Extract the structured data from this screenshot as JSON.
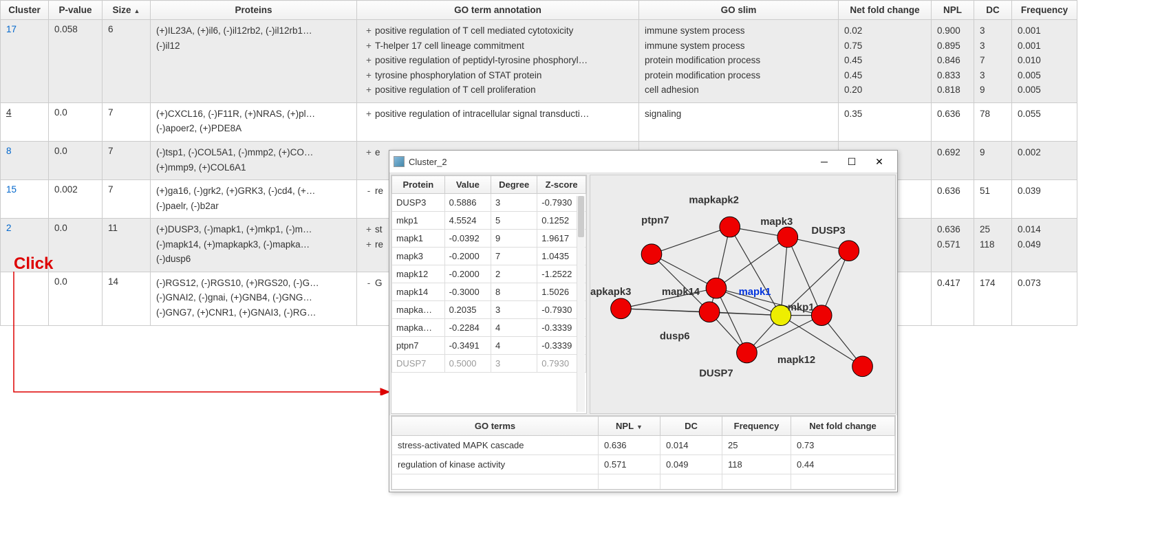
{
  "main_headers": {
    "cluster": "Cluster",
    "pvalue": "P-value",
    "size": "Size",
    "proteins": "Proteins",
    "go_term": "GO term annotation",
    "go_slim": "GO slim",
    "net_fold": "Net fold change",
    "npl": "NPL",
    "dc": "DC",
    "freq": "Frequency"
  },
  "rows": [
    {
      "cluster": "17",
      "pvalue": "0.058",
      "size": "6",
      "proteins": [
        "(+)IL23A, (+)il6, (-)il12rb2, (-)il12rb1…",
        "(-)il12"
      ],
      "go": [
        {
          "sign": "+",
          "term": "positive regulation of T cell mediated cytotoxicity",
          "slim": "immune system process",
          "nf": "0.02",
          "npl": "0.900",
          "dc": "3",
          "freq": "0.001"
        },
        {
          "sign": "+",
          "term": "T-helper 17 cell lineage commitment",
          "slim": "immune system process",
          "nf": "0.75",
          "npl": "0.895",
          "dc": "3",
          "freq": "0.001"
        },
        {
          "sign": "+",
          "term": "positive regulation of peptidyl-tyrosine phosphoryl…",
          "slim": "protein modification process",
          "nf": "0.45",
          "npl": "0.846",
          "dc": "7",
          "freq": "0.010"
        },
        {
          "sign": "+",
          "term": "tyrosine phosphorylation of STAT protein",
          "slim": "protein modification process",
          "nf": "0.45",
          "npl": "0.833",
          "dc": "3",
          "freq": "0.005"
        },
        {
          "sign": "+",
          "term": "positive regulation of T cell proliferation",
          "slim": "cell adhesion",
          "nf": "0.20",
          "npl": "0.818",
          "dc": "9",
          "freq": "0.005"
        }
      ]
    },
    {
      "cluster": "4",
      "underline": true,
      "pvalue": "0.0",
      "size": "7",
      "proteins": [
        "(+)CXCL16, (-)F11R, (+)NRAS, (+)pl…",
        "(-)apoer2, (+)PDE8A"
      ],
      "go": [
        {
          "sign": "+",
          "term": "positive regulation of intracellular signal transducti…",
          "slim": "signaling",
          "nf": "0.35",
          "npl": "0.636",
          "dc": "78",
          "freq": "0.055"
        }
      ]
    },
    {
      "cluster": "8",
      "pvalue": "0.0",
      "size": "7",
      "proteins": [
        "(-)tsp1, (-)COL5A1, (-)mmp2, (+)CO…",
        "(+)mmp9, (+)COL6A1"
      ],
      "go": [
        {
          "sign": "+",
          "term": "e",
          "slim": "",
          "nf": "",
          "npl": "0.692",
          "dc": "9",
          "freq": "0.002"
        }
      ]
    },
    {
      "cluster": "15",
      "pvalue": "0.002",
      "size": "7",
      "proteins": [
        "(+)ga16, (-)grk2, (+)GRK3, (-)cd4, (+…",
        "(-)paelr, (-)b2ar"
      ],
      "go": [
        {
          "sign": "-",
          "term": "re",
          "slim": "",
          "nf": "",
          "npl": "0.636",
          "dc": "51",
          "freq": "0.039"
        }
      ]
    },
    {
      "cluster": "2",
      "pvalue": "0.0",
      "size": "11",
      "proteins": [
        "(+)DUSP3, (-)mapk1, (+)mkp1, (-)m…",
        "(-)mapk14, (+)mapkapk3, (-)mapka…",
        "(-)dusp6"
      ],
      "go": [
        {
          "sign": "+",
          "term": "st",
          "slim": "",
          "nf": "",
          "npl": "0.636",
          "dc": "25",
          "freq": "0.014"
        },
        {
          "sign": "+",
          "term": "re",
          "slim": "",
          "nf": "",
          "npl": "0.571",
          "dc": "118",
          "freq": "0.049"
        }
      ]
    },
    {
      "cluster": "",
      "pvalue": "0.0",
      "size": "14",
      "proteins": [
        "(-)RGS12, (-)RGS10, (+)RGS20, (-)G…",
        "(-)GNAI2, (-)gnai, (+)GNB4, (-)GNG…",
        "(-)GNG7, (+)CNR1, (+)GNAI3, (-)RG…"
      ],
      "go": [
        {
          "sign": "-",
          "term": "G",
          "slim": "",
          "nf": "",
          "npl": "0.417",
          "dc": "174",
          "freq": "0.073"
        }
      ]
    }
  ],
  "click_label": "Click",
  "popup": {
    "title": "Cluster_2",
    "protein_headers": {
      "protein": "Protein",
      "value": "Value",
      "degree": "Degree",
      "zscore": "Z-score"
    },
    "proteins": [
      {
        "p": "DUSP3",
        "v": "0.5886",
        "d": "3",
        "z": "-0.7930"
      },
      {
        "p": "mkp1",
        "v": "4.5524",
        "d": "5",
        "z": "0.1252"
      },
      {
        "p": "mapk1",
        "v": "-0.0392",
        "d": "9",
        "z": "1.9617"
      },
      {
        "p": "mapk3",
        "v": "-0.2000",
        "d": "7",
        "z": "1.0435"
      },
      {
        "p": "mapk12",
        "v": "-0.2000",
        "d": "2",
        "z": "-1.2522"
      },
      {
        "p": "mapk14",
        "v": "-0.3000",
        "d": "8",
        "z": "1.5026"
      },
      {
        "p": "mapka…",
        "v": "0.2035",
        "d": "3",
        "z": "-0.7930"
      },
      {
        "p": "mapka…",
        "v": "-0.2284",
        "d": "4",
        "z": "-0.3339"
      },
      {
        "p": "ptpn7",
        "v": "-0.3491",
        "d": "4",
        "z": "-0.3339"
      },
      {
        "p": "DUSP7",
        "v": "0.5000",
        "d": "3",
        "z": "0.7930"
      }
    ],
    "graph_labels": {
      "mapkapk2": "mapkapk2",
      "ptpn7": "ptpn7",
      "mapk3": "mapk3",
      "dusp3": "DUSP3",
      "apkapk3": "apkapk3",
      "mapk14": "mapk14",
      "mapk1": "mapk1",
      "mkp1": "mkp1",
      "dusp6": "dusp6",
      "dusp7": "DUSP7",
      "mapk12": "mapk12"
    },
    "go_headers": {
      "go": "GO terms",
      "npl": "NPL",
      "dc": "DC",
      "freq": "Frequency",
      "nf": "Net fold change"
    },
    "go_rows": [
      {
        "go": "stress-activated MAPK cascade",
        "npl": "0.636",
        "dc": "0.014",
        "freq": "25",
        "nf": "0.73"
      },
      {
        "go": "regulation of kinase activity",
        "npl": "0.571",
        "dc": "0.049",
        "freq": "118",
        "nf": "0.44"
      }
    ]
  }
}
